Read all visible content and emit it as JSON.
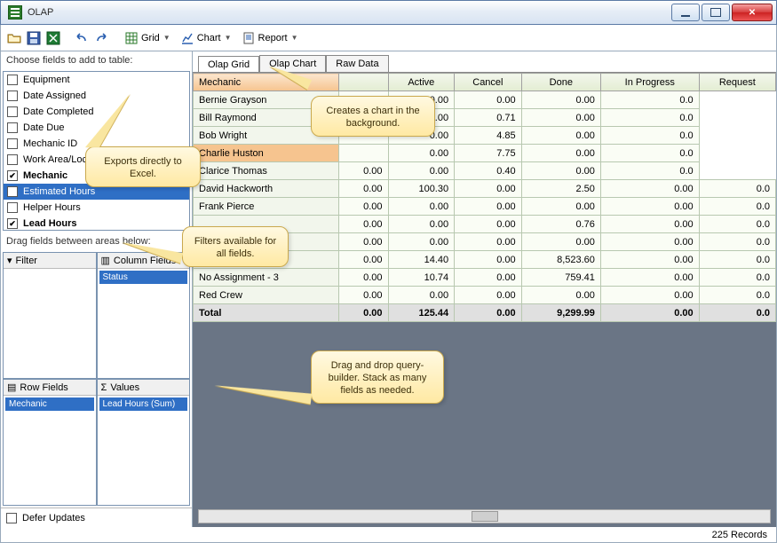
{
  "window": {
    "title": "OLAP"
  },
  "toolbar": {
    "grid_label": "Grid",
    "chart_label": "Chart",
    "report_label": "Report"
  },
  "left": {
    "choose_label": "Choose fields to add to table:",
    "fields": [
      {
        "label": "Equipment",
        "checked": false,
        "bold": false,
        "sel": false
      },
      {
        "label": "Date Assigned",
        "checked": false,
        "bold": false,
        "sel": false
      },
      {
        "label": "Date Completed",
        "checked": false,
        "bold": false,
        "sel": false
      },
      {
        "label": "Date Due",
        "checked": false,
        "bold": false,
        "sel": false
      },
      {
        "label": "Mechanic ID",
        "checked": false,
        "bold": false,
        "sel": false
      },
      {
        "label": "Work Area/Loc",
        "checked": false,
        "bold": false,
        "sel": false
      },
      {
        "label": "Mechanic",
        "checked": true,
        "bold": true,
        "sel": false
      },
      {
        "label": "Estimated Hours",
        "checked": false,
        "bold": false,
        "sel": true
      },
      {
        "label": "Helper Hours",
        "checked": false,
        "bold": false,
        "sel": false
      },
      {
        "label": "Lead Hours",
        "checked": true,
        "bold": true,
        "sel": false
      }
    ],
    "drag_label": "Drag fields between areas below:",
    "areas": {
      "filter": {
        "title": "Filter",
        "icon": "funnel-icon",
        "items": []
      },
      "columns": {
        "title": "Column Fields",
        "icon": "columns-icon",
        "items": [
          "Status"
        ]
      },
      "rows": {
        "title": "Row Fields",
        "icon": "rows-icon",
        "items": [
          "Mechanic"
        ]
      },
      "values": {
        "title": "Values",
        "icon": "sigma-icon",
        "items": [
          "Lead Hours (Sum)"
        ]
      }
    },
    "defer_label": "Defer Updates"
  },
  "tabs": [
    {
      "label": "Olap Grid",
      "active": true
    },
    {
      "label": "Olap Chart",
      "active": false
    },
    {
      "label": "Raw Data",
      "active": false
    }
  ],
  "grid": {
    "row_header": "Mechanic",
    "columns": [
      "Active",
      "Cancel",
      "Done",
      "In Progress",
      "Request"
    ],
    "rows": [
      {
        "label": "Bernie Grayson",
        "sel": false,
        "v": [
          "0.00",
          "0.00",
          "0.00",
          "0.00",
          "0.0"
        ]
      },
      {
        "label": "Bill Raymond",
        "sel": false,
        "v": [
          "",
          "0.00",
          "0.71",
          "0.00",
          "0.0"
        ]
      },
      {
        "label": "Bob Wright",
        "sel": false,
        "v": [
          "",
          "0.00",
          "4.85",
          "0.00",
          "0.0"
        ]
      },
      {
        "label": "Charlie Huston",
        "sel": true,
        "v": [
          "",
          "0.00",
          "7.75",
          "0.00",
          "0.0"
        ]
      },
      {
        "label": "Clarice Thomas",
        "sel": false,
        "v": [
          "0.00",
          "0.00",
          "0.40",
          "0.00",
          "0.0"
        ]
      },
      {
        "label": "David Hackworth",
        "sel": false,
        "v": [
          "0.00",
          "100.30",
          "0.00",
          "2.50",
          "0.00",
          "0.0"
        ]
      },
      {
        "label": "Frank Pierce",
        "sel": false,
        "v": [
          "0.00",
          "0.00",
          "0.00",
          "0.00",
          "0.00",
          "0.0"
        ]
      },
      {
        "label": "",
        "sel": false,
        "v": [
          "0.00",
          "0.00",
          "0.00",
          "0.76",
          "0.00",
          "0.0"
        ]
      },
      {
        "label": "",
        "sel": false,
        "v": [
          "0.00",
          "0.00",
          "0.00",
          "0.00",
          "0.00",
          "0.0"
        ]
      },
      {
        "label": "",
        "sel": false,
        "v": [
          "0.00",
          "14.40",
          "0.00",
          "8,523.60",
          "0.00",
          "0.0"
        ]
      },
      {
        "label": "No Assignment - 3",
        "sel": false,
        "v": [
          "0.00",
          "10.74",
          "0.00",
          "759.41",
          "0.00",
          "0.0"
        ]
      },
      {
        "label": "Red Crew",
        "sel": false,
        "v": [
          "0.00",
          "0.00",
          "0.00",
          "0.00",
          "0.00",
          "0.0"
        ]
      }
    ],
    "total": {
      "label": "Total",
      "v": [
        "0.00",
        "125.44",
        "0.00",
        "9,299.99",
        "0.00",
        "0.0"
      ]
    }
  },
  "status": {
    "records": "225 Records"
  },
  "callouts": {
    "excel": "Exports directly to Excel.",
    "chart": "Creates a chart in the background.",
    "filters": "Filters available for all fields.",
    "drag": "Drag and drop query-builder. Stack as many fields as needed."
  }
}
